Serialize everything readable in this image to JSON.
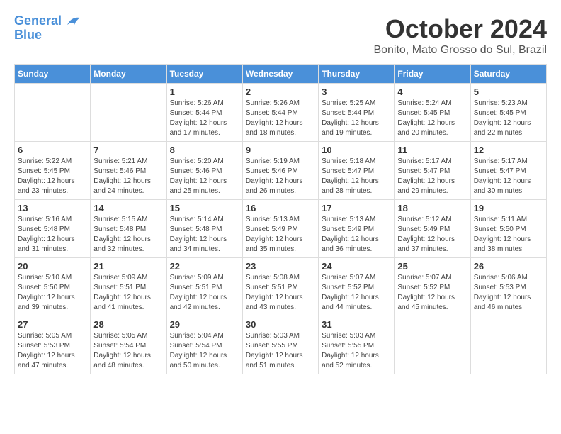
{
  "logo": {
    "line1": "General",
    "line2": "Blue"
  },
  "title": "October 2024",
  "location": "Bonito, Mato Grosso do Sul, Brazil",
  "days_of_week": [
    "Sunday",
    "Monday",
    "Tuesday",
    "Wednesday",
    "Thursday",
    "Friday",
    "Saturday"
  ],
  "weeks": [
    [
      {
        "day": "",
        "info": ""
      },
      {
        "day": "",
        "info": ""
      },
      {
        "day": "1",
        "sunrise": "5:26 AM",
        "sunset": "5:44 PM",
        "daylight": "12 hours and 17 minutes."
      },
      {
        "day": "2",
        "sunrise": "5:26 AM",
        "sunset": "5:44 PM",
        "daylight": "12 hours and 18 minutes."
      },
      {
        "day": "3",
        "sunrise": "5:25 AM",
        "sunset": "5:44 PM",
        "daylight": "12 hours and 19 minutes."
      },
      {
        "day": "4",
        "sunrise": "5:24 AM",
        "sunset": "5:45 PM",
        "daylight": "12 hours and 20 minutes."
      },
      {
        "day": "5",
        "sunrise": "5:23 AM",
        "sunset": "5:45 PM",
        "daylight": "12 hours and 22 minutes."
      }
    ],
    [
      {
        "day": "6",
        "sunrise": "5:22 AM",
        "sunset": "5:45 PM",
        "daylight": "12 hours and 23 minutes."
      },
      {
        "day": "7",
        "sunrise": "5:21 AM",
        "sunset": "5:46 PM",
        "daylight": "12 hours and 24 minutes."
      },
      {
        "day": "8",
        "sunrise": "5:20 AM",
        "sunset": "5:46 PM",
        "daylight": "12 hours and 25 minutes."
      },
      {
        "day": "9",
        "sunrise": "5:19 AM",
        "sunset": "5:46 PM",
        "daylight": "12 hours and 26 minutes."
      },
      {
        "day": "10",
        "sunrise": "5:18 AM",
        "sunset": "5:47 PM",
        "daylight": "12 hours and 28 minutes."
      },
      {
        "day": "11",
        "sunrise": "5:17 AM",
        "sunset": "5:47 PM",
        "daylight": "12 hours and 29 minutes."
      },
      {
        "day": "12",
        "sunrise": "5:17 AM",
        "sunset": "5:47 PM",
        "daylight": "12 hours and 30 minutes."
      }
    ],
    [
      {
        "day": "13",
        "sunrise": "5:16 AM",
        "sunset": "5:48 PM",
        "daylight": "12 hours and 31 minutes."
      },
      {
        "day": "14",
        "sunrise": "5:15 AM",
        "sunset": "5:48 PM",
        "daylight": "12 hours and 32 minutes."
      },
      {
        "day": "15",
        "sunrise": "5:14 AM",
        "sunset": "5:48 PM",
        "daylight": "12 hours and 34 minutes."
      },
      {
        "day": "16",
        "sunrise": "5:13 AM",
        "sunset": "5:49 PM",
        "daylight": "12 hours and 35 minutes."
      },
      {
        "day": "17",
        "sunrise": "5:13 AM",
        "sunset": "5:49 PM",
        "daylight": "12 hours and 36 minutes."
      },
      {
        "day": "18",
        "sunrise": "5:12 AM",
        "sunset": "5:49 PM",
        "daylight": "12 hours and 37 minutes."
      },
      {
        "day": "19",
        "sunrise": "5:11 AM",
        "sunset": "5:50 PM",
        "daylight": "12 hours and 38 minutes."
      }
    ],
    [
      {
        "day": "20",
        "sunrise": "5:10 AM",
        "sunset": "5:50 PM",
        "daylight": "12 hours and 39 minutes."
      },
      {
        "day": "21",
        "sunrise": "5:09 AM",
        "sunset": "5:51 PM",
        "daylight": "12 hours and 41 minutes."
      },
      {
        "day": "22",
        "sunrise": "5:09 AM",
        "sunset": "5:51 PM",
        "daylight": "12 hours and 42 minutes."
      },
      {
        "day": "23",
        "sunrise": "5:08 AM",
        "sunset": "5:51 PM",
        "daylight": "12 hours and 43 minutes."
      },
      {
        "day": "24",
        "sunrise": "5:07 AM",
        "sunset": "5:52 PM",
        "daylight": "12 hours and 44 minutes."
      },
      {
        "day": "25",
        "sunrise": "5:07 AM",
        "sunset": "5:52 PM",
        "daylight": "12 hours and 45 minutes."
      },
      {
        "day": "26",
        "sunrise": "5:06 AM",
        "sunset": "5:53 PM",
        "daylight": "12 hours and 46 minutes."
      }
    ],
    [
      {
        "day": "27",
        "sunrise": "5:05 AM",
        "sunset": "5:53 PM",
        "daylight": "12 hours and 47 minutes."
      },
      {
        "day": "28",
        "sunrise": "5:05 AM",
        "sunset": "5:54 PM",
        "daylight": "12 hours and 48 minutes."
      },
      {
        "day": "29",
        "sunrise": "5:04 AM",
        "sunset": "5:54 PM",
        "daylight": "12 hours and 50 minutes."
      },
      {
        "day": "30",
        "sunrise": "5:03 AM",
        "sunset": "5:55 PM",
        "daylight": "12 hours and 51 minutes."
      },
      {
        "day": "31",
        "sunrise": "5:03 AM",
        "sunset": "5:55 PM",
        "daylight": "12 hours and 52 minutes."
      },
      {
        "day": "",
        "info": ""
      },
      {
        "day": "",
        "info": ""
      }
    ]
  ],
  "labels": {
    "sunrise": "Sunrise:",
    "sunset": "Sunset:",
    "daylight": "Daylight:"
  }
}
